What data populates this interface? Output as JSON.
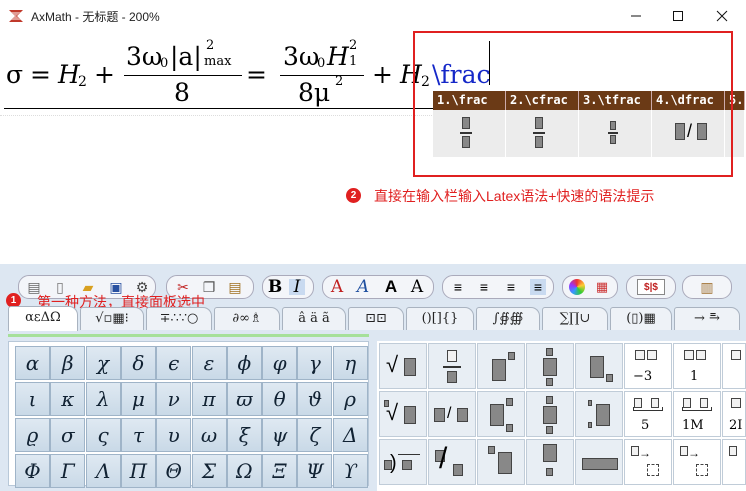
{
  "window": {
    "title": "AxMath - 无标题 - 200%"
  },
  "formula": {
    "sigma": "σ",
    "eq": "=",
    "h2": "H",
    "sub2": "2",
    "plus": "+",
    "num1": "3ω",
    "num1b": "0",
    "abar": "|a|",
    "sup2": "2",
    "max": "max",
    "den1": "8",
    "eq2": "=",
    "num2": "3ω",
    "num2b": "0",
    "num2c": "H",
    "sub1": "1",
    "sup2b": "2",
    "den2": "8μ",
    "sup2c": "2",
    "plus2": "+",
    "h2b": "H",
    "sub2b": "2",
    "latex": "\\frac"
  },
  "suggestions": {
    "items": [
      "1.\\frac",
      "2.\\cfrac",
      "3.\\tfrac",
      "4.\\dfrac",
      "5.\\"
    ]
  },
  "annotations": {
    "note1_num": "1",
    "note1": "第一种方法，直接面板选中",
    "note2_num": "2",
    "note2": "直接在输入栏输入Latex语法+快速的语法提示"
  },
  "toolbar": {
    "bold": "B",
    "italic": "I",
    "a1": "A",
    "a2": "A",
    "a3": "A",
    "a4": "A",
    "money": "$|$"
  },
  "tabs": [
    "αεΔΩ",
    "√▫▦⁝",
    "∓∴∵○",
    "∂∞♗",
    "â ä ã",
    "⊡⊡",
    "()[]{}",
    "∫∯∰",
    "∑∏∪",
    "(▯)▦",
    "→ ⥱"
  ],
  "greek": [
    [
      "α",
      "β",
      "χ",
      "δ",
      "ϵ",
      "ε",
      "ϕ",
      "φ",
      "γ",
      "η"
    ],
    [
      "ι",
      "κ",
      "λ",
      "μ",
      "ν",
      "π",
      "ϖ",
      "θ",
      "ϑ",
      "ρ"
    ],
    [
      "ϱ",
      "σ",
      "ς",
      "τ",
      "υ",
      "ω",
      "ξ",
      "ψ",
      "ζ",
      "Δ"
    ],
    [
      "Φ",
      "Γ",
      "Λ",
      "Π",
      "Θ",
      "Σ",
      "Ω",
      "Ξ",
      "Ψ",
      "ϒ"
    ]
  ],
  "templates": {
    "t1": "−3",
    "t2": "1",
    "t3": "5",
    "t4": "1M",
    "t5": "2I"
  },
  "colors": {
    "accent": "#e02020",
    "suggest_head": "#6b3a16",
    "latex": "#1528c8"
  }
}
